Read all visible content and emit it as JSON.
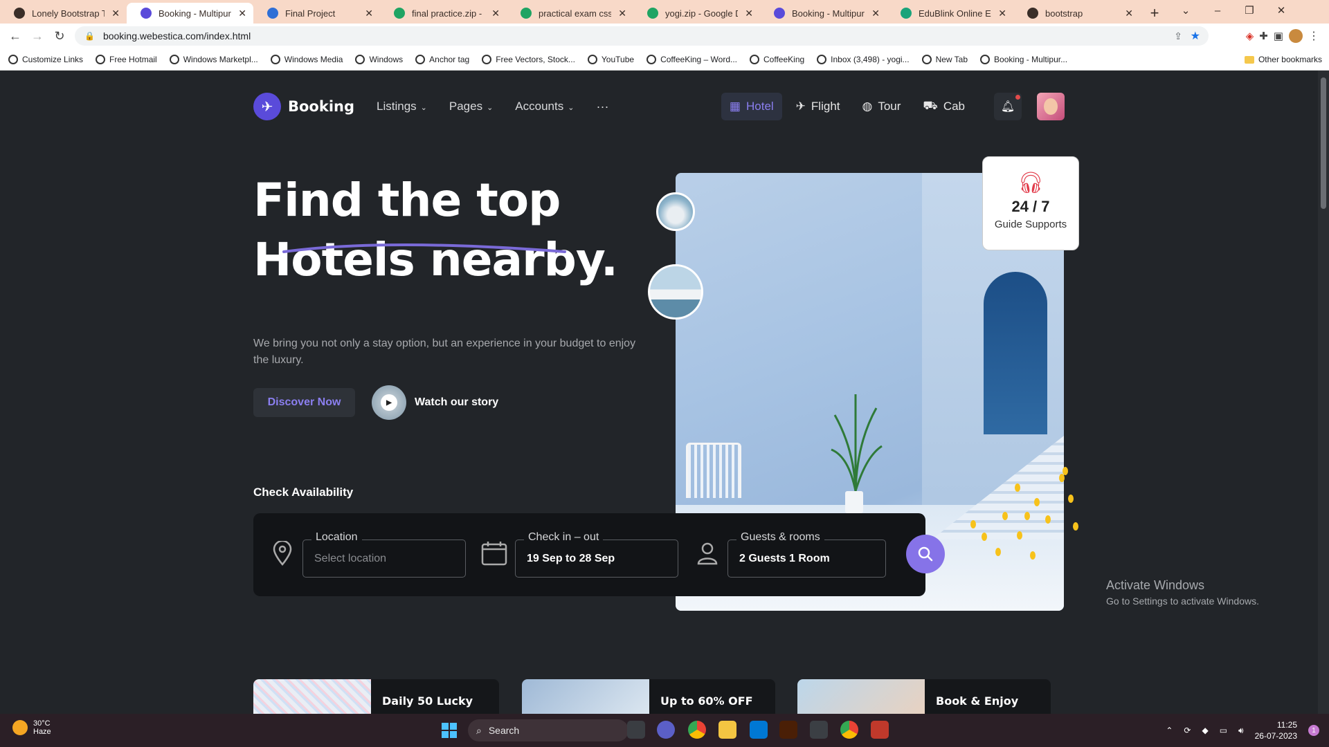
{
  "browser": {
    "tabs": [
      {
        "title": "Lonely Bootstrap Temp",
        "color": "#3a2e28",
        "active": false
      },
      {
        "title": "Booking - Multipurpo",
        "color": "#5a4bda",
        "active": true
      },
      {
        "title": "Final Project",
        "color": "#2f6fd6",
        "active": false
      },
      {
        "title": "final practice.zip - Goo",
        "color": "#1fa463",
        "active": false
      },
      {
        "title": "practical exam css.zip",
        "color": "#1fa463",
        "active": false
      },
      {
        "title": "yogi.zip - Google Driv",
        "color": "#1fa463",
        "active": false
      },
      {
        "title": "Booking - Multipurpo",
        "color": "#5a4bda",
        "active": false
      },
      {
        "title": "EduBlink Online Educa",
        "color": "#1aa37a",
        "active": false
      },
      {
        "title": "bootstrap",
        "color": "#3a2e28",
        "active": false
      }
    ],
    "url": "booking.webestica.com/index.html",
    "bookmarks": [
      "Customize Links",
      "Free Hotmail",
      "Windows Marketpl...",
      "Windows Media",
      "Windows",
      "Anchor tag",
      "Free Vectors, Stock...",
      "YouTube",
      "CoffeeKing – Word...",
      "CoffeeKing",
      "Inbox (3,498) - yogi...",
      "New Tab",
      "Booking - Multipur..."
    ],
    "other_bookmarks": "Other bookmarks"
  },
  "nav": {
    "brand": "Booking",
    "menu": [
      "Listings",
      "Pages",
      "Accounts"
    ],
    "more": "···",
    "categories": [
      {
        "label": "Hotel",
        "icon": "building-icon",
        "active": true
      },
      {
        "label": "Flight",
        "icon": "plane-icon",
        "active": false
      },
      {
        "label": "Tour",
        "icon": "globe-icon",
        "active": false
      },
      {
        "label": "Cab",
        "icon": "car-icon",
        "active": false
      }
    ]
  },
  "hero": {
    "title_line1": "Find the top",
    "title_line2": "Hotels nearby.",
    "subtitle": "We bring you not only a stay option, but an experience in your budget to enjoy the luxury.",
    "discover_label": "Discover Now",
    "watch_label": "Watch our story"
  },
  "support": {
    "value": "24 / 7",
    "label": "Guide Supports"
  },
  "availability": {
    "title": "Check Availability",
    "location": {
      "legend": "Location",
      "placeholder": "Select location"
    },
    "checkin": {
      "legend": "Check in – out",
      "value": "19 Sep to 28 Sep"
    },
    "guests": {
      "legend": "Guests & rooms",
      "value": "2 Guests 1 Room"
    }
  },
  "promos": [
    "Daily 50 Lucky",
    "Up to 60% OFF",
    "Book & Enjoy"
  ],
  "activate": {
    "title": "Activate Windows",
    "subtitle": "Go to Settings to activate Windows."
  },
  "taskbar": {
    "temp": "30°C",
    "condition": "Haze",
    "search": "Search",
    "time": "11:25",
    "date": "26-07-2023",
    "notifications": "1"
  },
  "colors": {
    "accent": "#8673e8",
    "background": "#222529",
    "panel": "#121417"
  }
}
